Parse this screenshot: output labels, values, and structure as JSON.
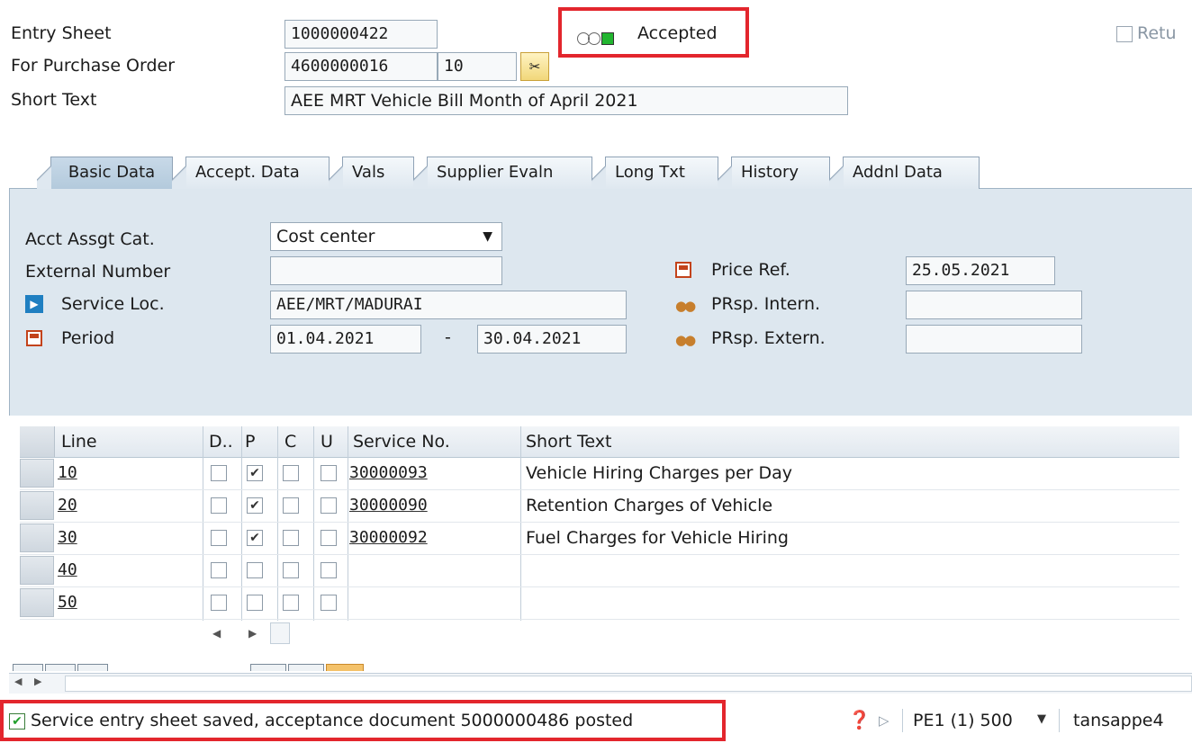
{
  "header": {
    "entry_sheet_label": "Entry Sheet",
    "entry_sheet_value": "1000000422",
    "po_label": "For Purchase Order",
    "po_value": "4600000016",
    "po_item": "10",
    "short_text_label": "Short Text",
    "short_text_value": "AEE MRT Vehicle Bill Month of April 2021",
    "status_text": "Accepted",
    "return_label": "Retu"
  },
  "tabs": [
    {
      "label": "Basic Data"
    },
    {
      "label": "Accept. Data"
    },
    {
      "label": "Vals"
    },
    {
      "label": "Supplier Evaln"
    },
    {
      "label": "Long Txt"
    },
    {
      "label": "History"
    },
    {
      "label": "Addnl Data"
    }
  ],
  "basic": {
    "acct_label": "Acct Assgt Cat.",
    "acct_value": "Cost center",
    "ext_label": "External Number",
    "ext_value": "",
    "service_loc_label": "Service Loc.",
    "service_loc_value": "AEE/MRT/MADURAI",
    "period_label": "Period",
    "period_from": "01.04.2021",
    "period_sep": "-",
    "period_to": "30.04.2021",
    "price_ref_label": "Price Ref.",
    "price_ref_value": "25.05.2021",
    "prsp_intern_label": "PRsp. Intern.",
    "prsp_intern_value": "",
    "prsp_extern_label": "PRsp. Extern.",
    "prsp_extern_value": ""
  },
  "table": {
    "columns": {
      "line": "Line",
      "d": "D..",
      "p": "P",
      "c": "C",
      "u": "U",
      "service_no": "Service No.",
      "short_text": "Short Text"
    },
    "rows": [
      {
        "line": "10",
        "p": true,
        "service_no": "30000093",
        "short_text": "Vehicle Hiring Charges per Day"
      },
      {
        "line": "20",
        "p": true,
        "service_no": "30000090",
        "short_text": "Retention Charges of Vehicle"
      },
      {
        "line": "30",
        "p": true,
        "service_no": "30000092",
        "short_text": "Fuel Charges for Vehicle Hiring"
      },
      {
        "line": "40",
        "p": false,
        "service_no": "",
        "short_text": ""
      },
      {
        "line": "50",
        "p": false,
        "service_no": "",
        "short_text": ""
      }
    ]
  },
  "status": {
    "message": "Service entry sheet saved, acceptance document 5000000486 posted",
    "system": "PE1 (1) 500",
    "user": "tansappe4"
  },
  "colors": {
    "accent_red": "#e3262d",
    "status_green": "#22b530",
    "tab_active": "#b3cadc"
  }
}
